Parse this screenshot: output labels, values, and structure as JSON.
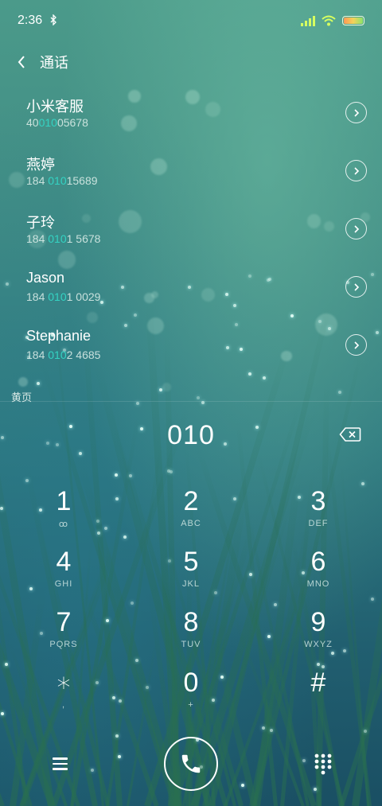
{
  "status_bar": {
    "time": "2:36",
    "icons": [
      "bluetooth-icon",
      "signal-icon",
      "wifi-icon",
      "battery-icon"
    ]
  },
  "header": {
    "title": "通话",
    "back_icon": "chevron-left-icon"
  },
  "contacts": [
    {
      "name": "小米客服",
      "number_pre": "40",
      "number_hl": "010",
      "number_post": "05678"
    },
    {
      "name": "燕婷",
      "number_pre": "184 ",
      "number_hl": "010",
      "number_post": "15689"
    },
    {
      "name": "子玲",
      "number_pre": "184 ",
      "number_hl": "010",
      "number_post": "1 5678"
    },
    {
      "name": "Jason",
      "number_pre": "184 ",
      "number_hl": "010",
      "number_post": "1 0029"
    },
    {
      "name": "Stephanie",
      "number_pre": "184 ",
      "number_hl": "010",
      "number_post": "2 4685"
    }
  ],
  "yellow_pages_label": "黄页",
  "dialer": {
    "display": "010",
    "backspace_icon": "backspace-icon"
  },
  "keypad": [
    {
      "digit": "1",
      "letters": "ꝏ"
    },
    {
      "digit": "2",
      "letters": "ABC"
    },
    {
      "digit": "3",
      "letters": "DEF"
    },
    {
      "digit": "4",
      "letters": "GHI"
    },
    {
      "digit": "5",
      "letters": "JKL"
    },
    {
      "digit": "6",
      "letters": "MNO"
    },
    {
      "digit": "7",
      "letters": "PQRS"
    },
    {
      "digit": "8",
      "letters": "TUV"
    },
    {
      "digit": "9",
      "letters": "WXYZ"
    },
    {
      "digit": "∗",
      "letters": ","
    },
    {
      "digit": "0",
      "letters": "+"
    },
    {
      "digit": "#",
      "letters": ""
    }
  ],
  "bottom_bar": {
    "menu_icon": "menu-icon",
    "call_icon": "phone-icon",
    "keypad_icon": "dialpad-icon"
  },
  "colors": {
    "highlight": "#34d3c3",
    "background_top": "#4b9a8a",
    "background_bottom": "#1a4f63"
  }
}
